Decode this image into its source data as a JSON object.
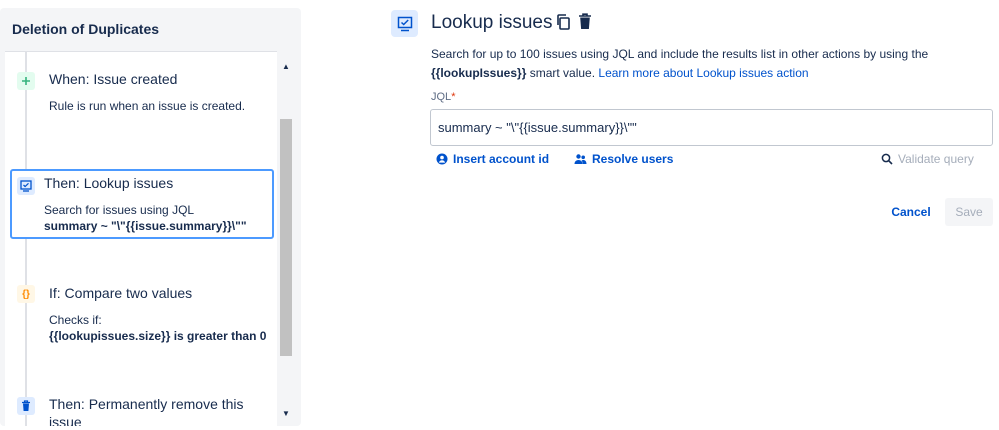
{
  "sidebar": {
    "title": "Deletion of Duplicates",
    "items": [
      {
        "icon": "plus-icon",
        "title": "When: Issue created",
        "desc": "Rule is run when an issue is created."
      },
      {
        "icon": "lookup-issues-icon",
        "title": "Then: Lookup issues",
        "desc_line1": "Search for issues using JQL",
        "desc_line2": "summary ~ \"\\\"{{issue.summary}}\\\"\""
      },
      {
        "icon": "braces-icon",
        "icon_glyph": "{}",
        "title": "If: Compare two values",
        "desc_line1": "Checks if:",
        "desc_line2": "{{lookupissues.size}} is greater than 0"
      },
      {
        "icon": "trash-icon",
        "title": "Then: Permanently remove this issue"
      }
    ]
  },
  "editor": {
    "title": "Lookup issues",
    "desc_part1": "Search for up to 100 issues using JQL and include the results list in other actions by using the ",
    "smart_value": "{{lookupIssues}}",
    "desc_part2": " smart value. ",
    "learn_more": "Learn more about Lookup issues action",
    "jql_label": "JQL",
    "jql_required": "*",
    "jql_value": "summary ~ \"\\\"{{issue.summary}}\\\"\"",
    "insert_account_id": "Insert account id",
    "resolve_users": "Resolve users",
    "validate_query": "Validate query",
    "cancel": "Cancel",
    "save": "Save"
  },
  "colors": {
    "accent": "#0052cc",
    "selected_border": "#4c9aff",
    "trigger_green": "#36b37e",
    "condition_orange": "#ff8b00",
    "required_red": "#de350b"
  }
}
